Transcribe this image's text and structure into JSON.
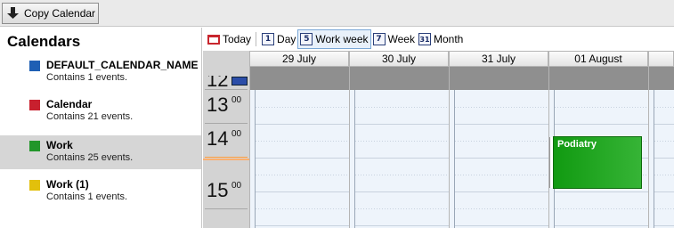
{
  "toolbar": {
    "copy_label": "Copy Calendar"
  },
  "sidebar": {
    "title": "Calendars",
    "items": [
      {
        "name": "DEFAULT_CALENDAR_NAME",
        "count": "Contains 1 events.",
        "color": "#1e5fb4"
      },
      {
        "name": "Calendar",
        "count": "Contains 21 events.",
        "color": "#c8202e"
      },
      {
        "name": "Work",
        "count": "Contains 25 events.",
        "color": "#22962a"
      },
      {
        "name": "Work (1)",
        "count": "Contains 1 events.",
        "color": "#e2c00c"
      }
    ]
  },
  "viewbar": {
    "today": "Today",
    "day": "Day",
    "day_icon": "1",
    "workweek": "Work week",
    "workweek_icon": "5",
    "week": "Week",
    "week_icon": "7",
    "month": "Month",
    "month_icon": "31"
  },
  "hours": [
    {
      "h": "12",
      "m": ""
    },
    {
      "h": "13",
      "m": "00"
    },
    {
      "h": "14",
      "m": "00"
    },
    {
      "h": "15",
      "m": "00"
    }
  ],
  "days": [
    "29 July",
    "30 July",
    "31 July",
    "01 August",
    ""
  ],
  "event": {
    "title": "Podiatry",
    "color": "#22962a"
  }
}
